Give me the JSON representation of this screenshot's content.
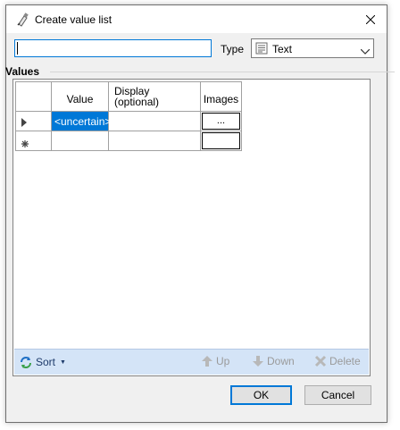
{
  "window": {
    "title": "Create value list"
  },
  "form": {
    "name_value": "",
    "type_label": "Type",
    "type_selected": "Text"
  },
  "section": {
    "label": "Values"
  },
  "grid": {
    "headers": {
      "value": "Value",
      "display": "Display (optional)",
      "images": "Images"
    },
    "rows": [
      {
        "value": "<uncertain>",
        "display": "",
        "image_button": "..."
      }
    ]
  },
  "toolbar": {
    "sort": "Sort",
    "up": "Up",
    "down": "Down",
    "delete": "Delete"
  },
  "buttons": {
    "ok": "OK",
    "cancel": "Cancel"
  },
  "colors": {
    "accent": "#0078d7",
    "toolbar_bg": "#d4e4f7",
    "disabled_text": "#9a9a9a"
  }
}
